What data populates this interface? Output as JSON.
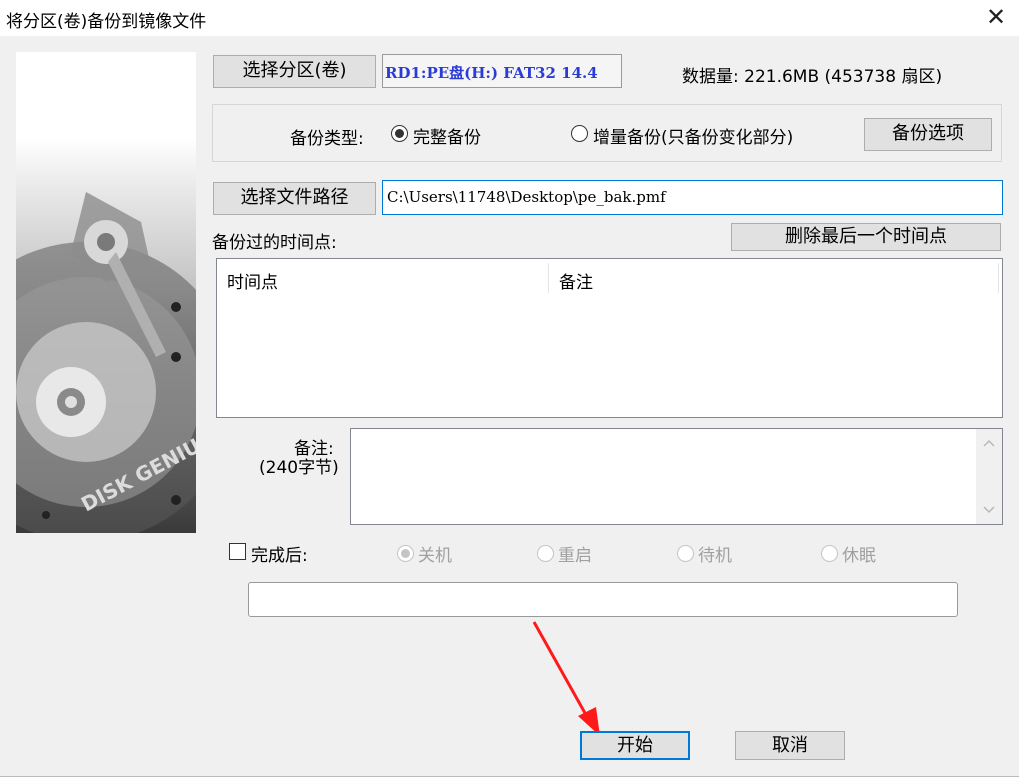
{
  "window": {
    "title": "将分区(卷)备份到镜像文件",
    "close_glyph": "✕"
  },
  "top": {
    "select_partition_label": "选择分区(卷)",
    "partition_value": "RD1:PE盘(H:) FAT32 14.4",
    "data_size_text": "数据量: 221.6MB (453738 扇区)"
  },
  "backup_type": {
    "label": "备份类型:",
    "full_label": "完整备份",
    "incremental_label": "增量备份(只备份变化部分)",
    "options_button": "备份选项",
    "selected": "full"
  },
  "file_path": {
    "button_label": "选择文件路径",
    "value": "C:\\Users\\11748\\Desktop\\pe_bak.pmf"
  },
  "timepoints": {
    "label": "备份过的时间点:",
    "delete_button": "删除最后一个时间点",
    "columns": [
      "时间点",
      "备注"
    ]
  },
  "notes": {
    "label_line1": "备注:",
    "label_line2": "(240字节)",
    "value": ""
  },
  "after_complete": {
    "label": "完成后:",
    "options": [
      "关机",
      "重启",
      "待机",
      "休眠"
    ],
    "checked": false
  },
  "buttons": {
    "start": "开始",
    "cancel": "取消"
  },
  "image": {
    "brand_text": "DISK GENIUS"
  },
  "colors": {
    "partition_text": "#2b3bd6",
    "accent": "#0078d7",
    "arrow": "#ff1a1a"
  }
}
